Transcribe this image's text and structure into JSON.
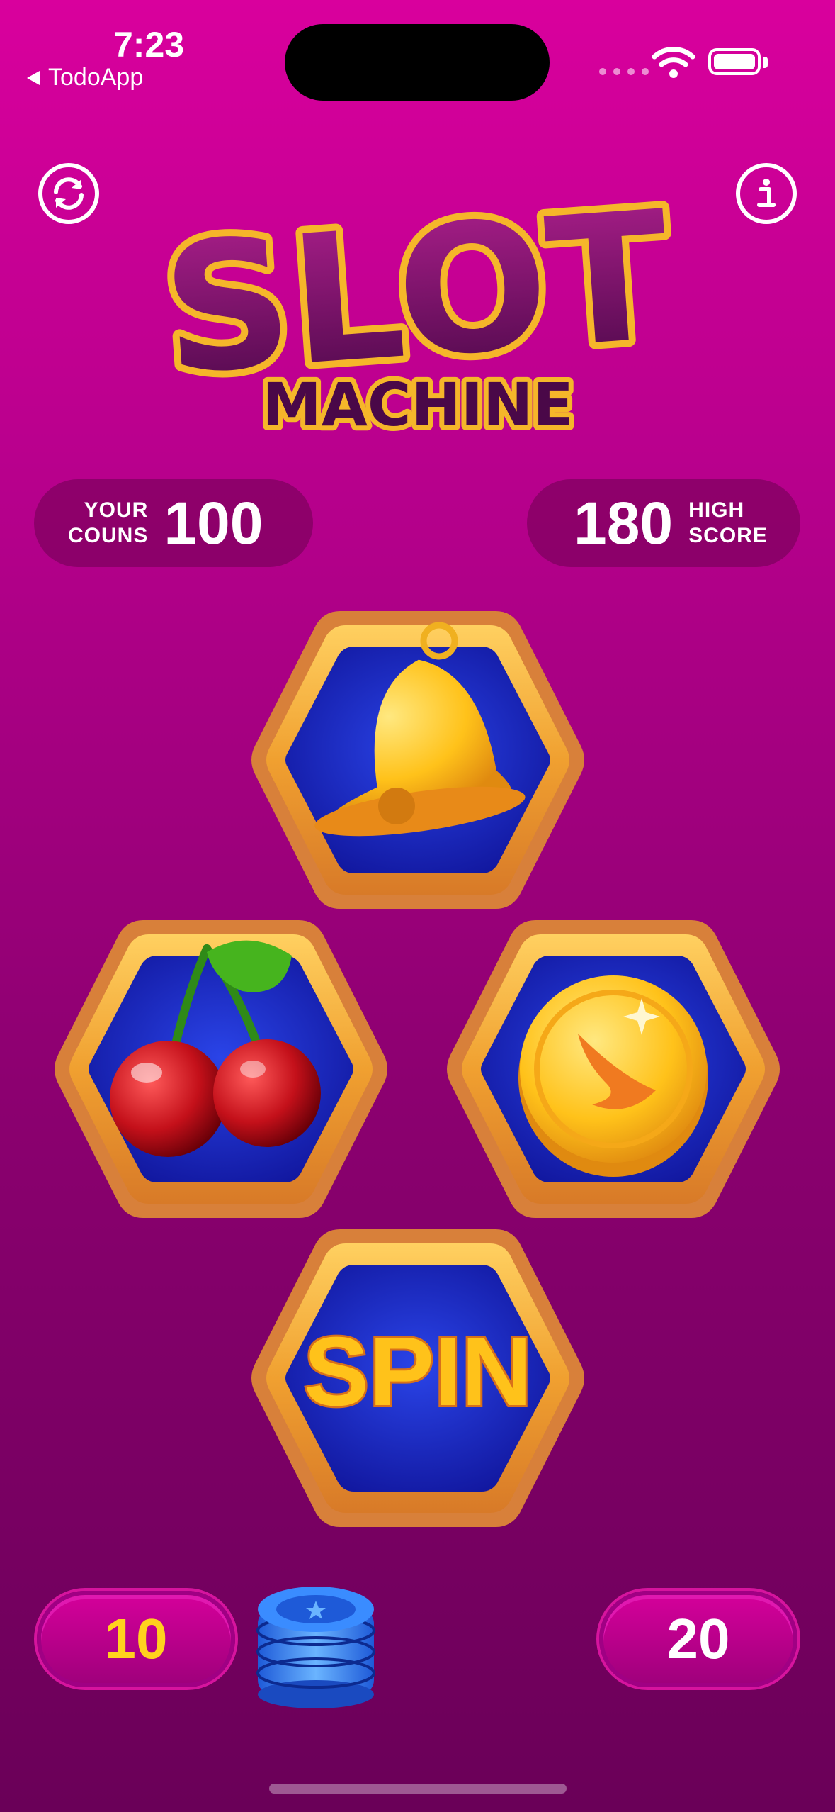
{
  "status_bar": {
    "time": "7:23",
    "back_app": "TodoApp",
    "back_icon": "back-triangle-icon",
    "wifi_icon": "wifi-icon",
    "battery_icon": "battery-icon"
  },
  "header": {
    "reset_icon": "arrow-circle-icon",
    "info_icon": "info-icon",
    "logo_line1": "SLOT",
    "logo_line2": "MACHINE"
  },
  "scores": {
    "coins_label_1": "YOUR",
    "coins_label_2": "COUNS",
    "coins_value": "100",
    "high_value": "180",
    "high_label_1": "HIGH",
    "high_label_2": "SCORE"
  },
  "reels": [
    {
      "symbol": "bell-icon"
    },
    {
      "symbol": "cherry-icon"
    },
    {
      "symbol": "coin-icon"
    }
  ],
  "spin": {
    "label": "SPIN"
  },
  "bets": {
    "bet_small": "10",
    "bet_large": "20",
    "chips_icon": "casino-chips-icon"
  },
  "colors": {
    "background_top": "#d9009d",
    "background_bottom": "#6a0058",
    "frame_gold": "#f5b83a",
    "reel_blue": "#1a2bb8",
    "accent_yellow": "#ffd21e"
  }
}
